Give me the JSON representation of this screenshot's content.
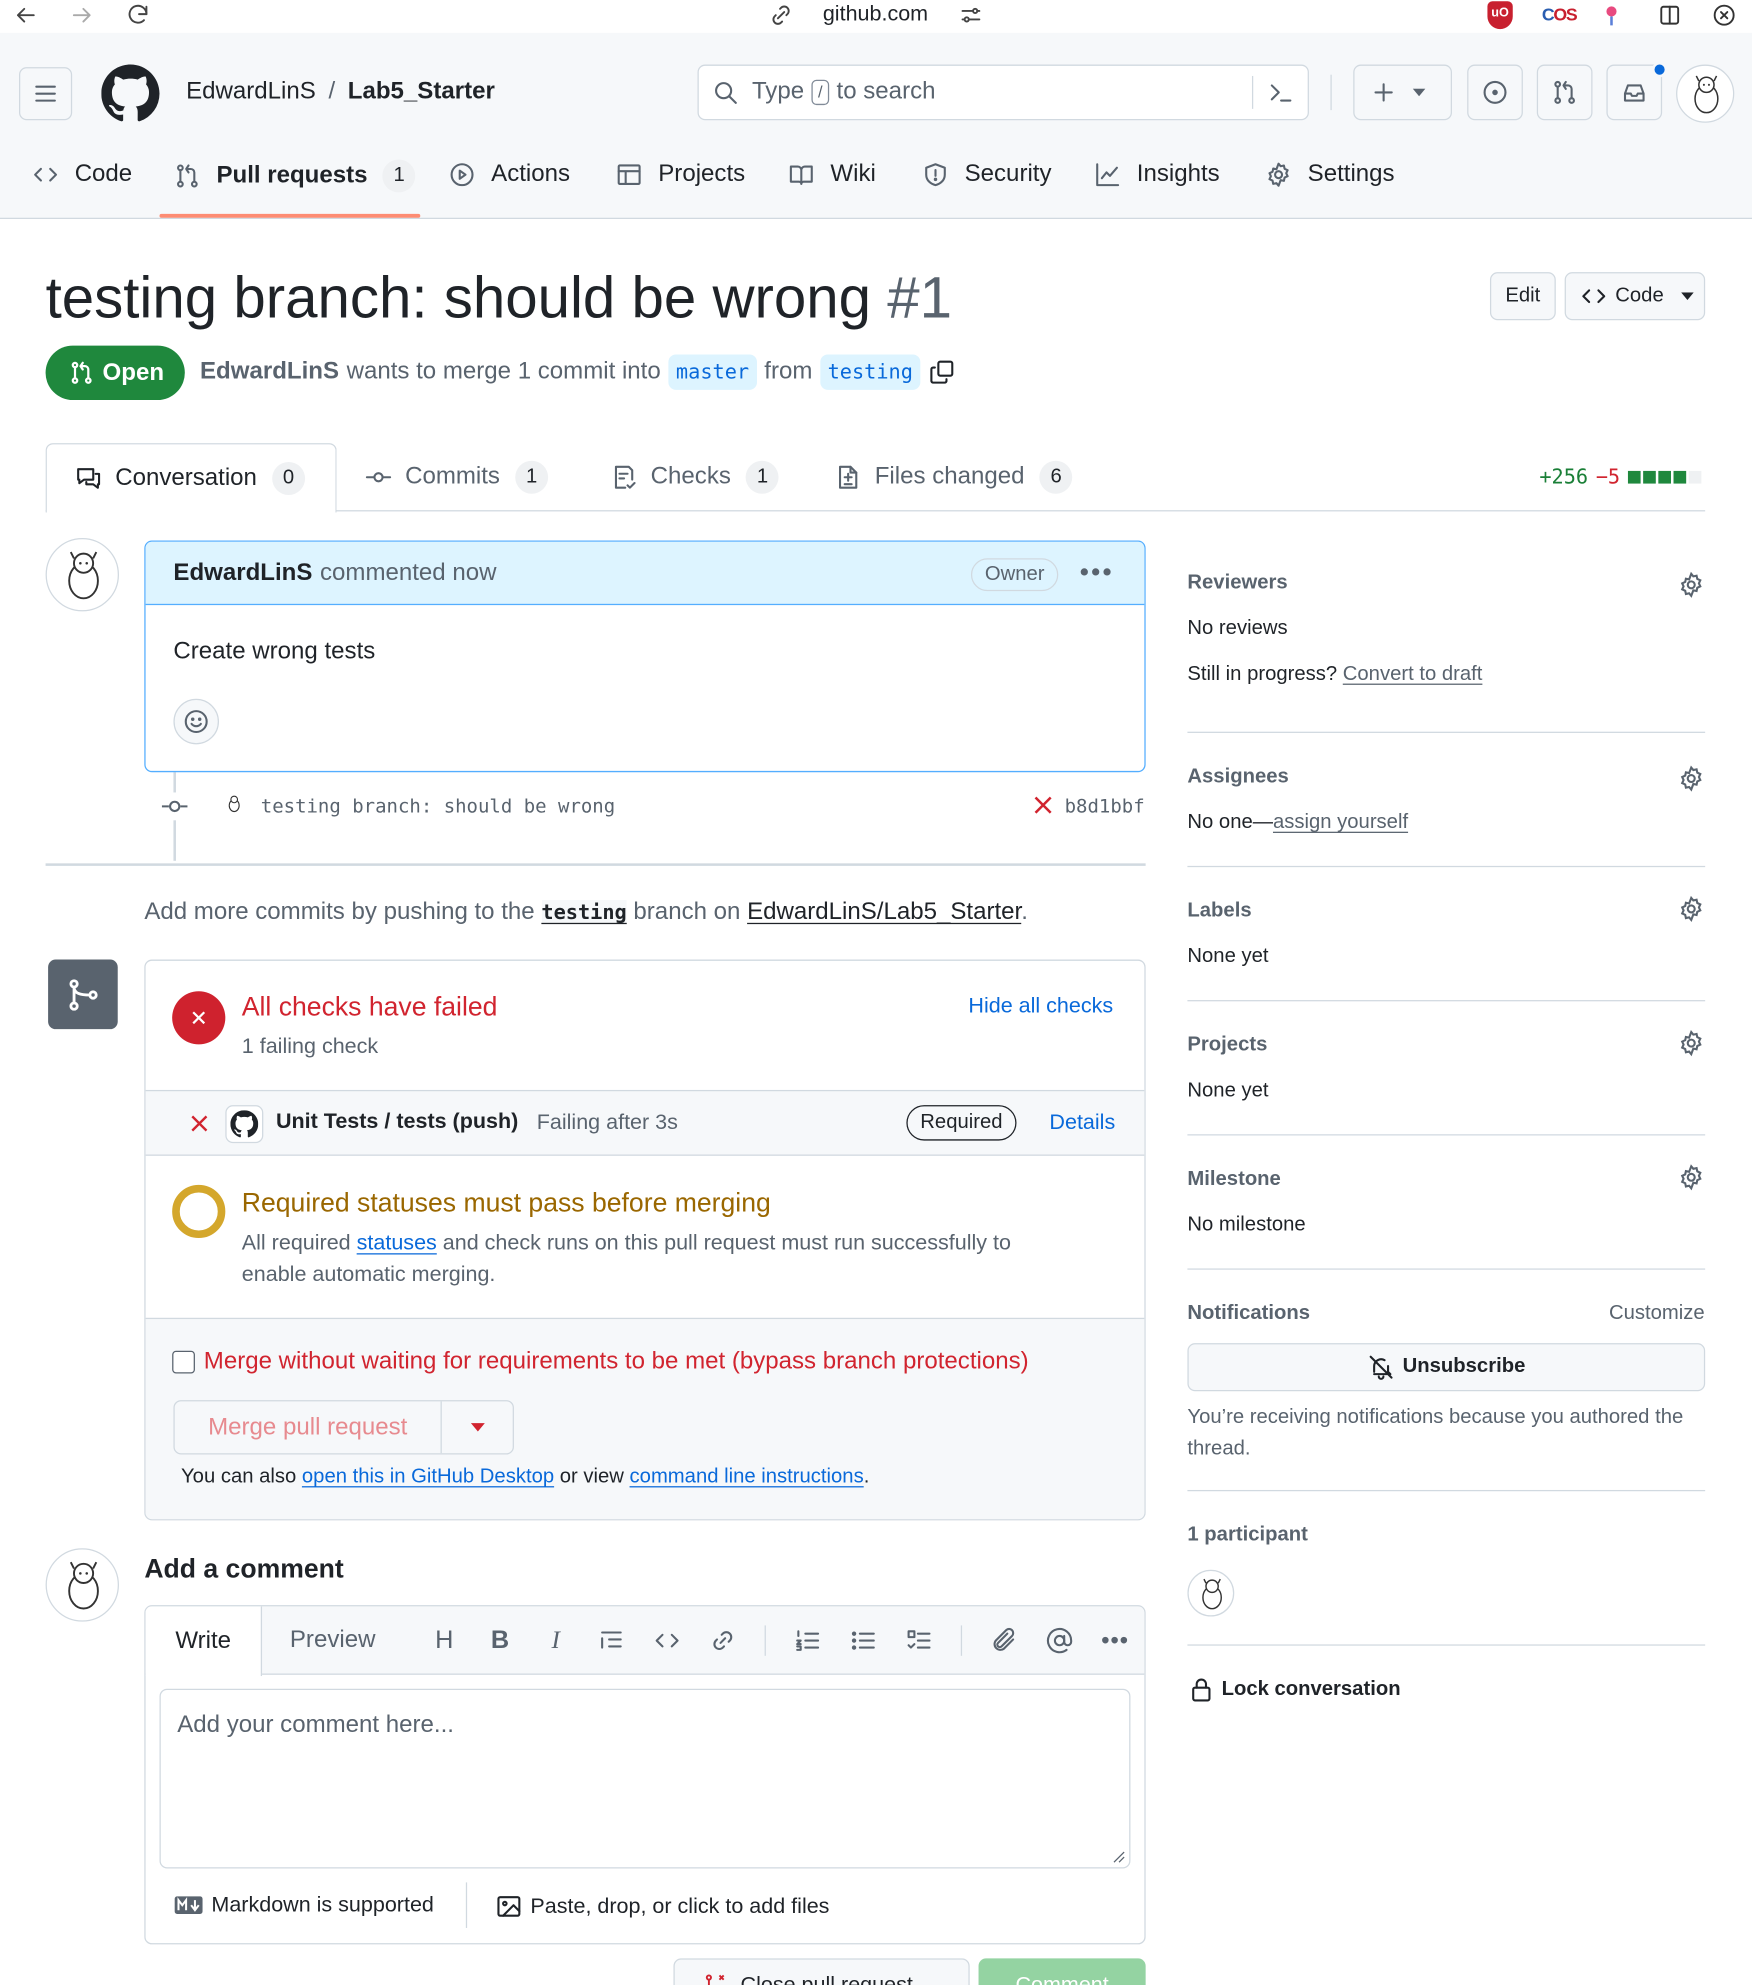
{
  "browser": {
    "url": "github.com"
  },
  "header": {
    "owner": "EdwardLinS",
    "separator": "/",
    "repo": "Lab5_Starter",
    "search_type": "Type",
    "search_key": "/",
    "search_rest": "to search"
  },
  "repo_nav": {
    "code": "Code",
    "pull_requests": "Pull requests",
    "pull_requests_count": "1",
    "actions": "Actions",
    "projects": "Projects",
    "wiki": "Wiki",
    "security": "Security",
    "insights": "Insights",
    "settings": "Settings"
  },
  "pr": {
    "title": "testing branch: should be wrong",
    "number": "#1",
    "edit": "Edit",
    "code": "Code",
    "state": "Open",
    "author": "EdwardLinS",
    "meta_1": "wants to merge 1 commit into",
    "base": "master",
    "meta_2": "from",
    "head": "testing"
  },
  "tabs": {
    "conversation": "Conversation",
    "conversation_count": "0",
    "commits": "Commits",
    "commits_count": "1",
    "checks": "Checks",
    "checks_count": "1",
    "files": "Files changed",
    "files_count": "6",
    "additions": "+256",
    "deletions": "−5"
  },
  "comment": {
    "author": "EdwardLinS",
    "action": "commented now",
    "role": "Owner",
    "body": "Create wrong tests"
  },
  "commit": {
    "message": "testing branch: should be wrong",
    "sha": "b8d1bbf"
  },
  "push_hint": {
    "prefix": "Add more commits by pushing to the",
    "branch": "testing",
    "middle": "branch on",
    "repo": "EdwardLinS/Lab5_Starter",
    "suffix": "."
  },
  "checks": {
    "title": "All checks have failed",
    "subtitle": "1 failing check",
    "hide": "Hide all checks",
    "check_name": "Unit Tests / tests (push)",
    "check_status": "Failing after 3s",
    "required": "Required",
    "details": "Details",
    "req_title": "Required statuses must pass before merging",
    "req_text_1": "All required",
    "req_link": "statuses",
    "req_text_2": "and check runs on this pull request must run successfully to enable automatic merging."
  },
  "merge": {
    "bypass": "Merge without waiting for requirements to be met (bypass branch protections)",
    "button": "Merge pull request",
    "also_1": "You can also",
    "desktop_link": "open this in GitHub Desktop",
    "also_2": "or view",
    "cli_link": "command line instructions",
    "also_3": "."
  },
  "add_comment": {
    "title": "Add a comment",
    "write": "Write",
    "preview": "Preview",
    "placeholder": "Add your comment here...",
    "markdown": "Markdown is supported",
    "files": "Paste, drop, or click to add files",
    "close_pr": "Close pull request",
    "comment_btn": "Comment"
  },
  "sidebar": {
    "reviewers": "Reviewers",
    "reviewers_value": "No reviews",
    "draft_q": "Still in progress?",
    "draft_link": "Convert to draft",
    "assignees": "Assignees",
    "assignees_value": "No one—",
    "assign_link": "assign yourself",
    "labels": "Labels",
    "labels_value": "None yet",
    "projects": "Projects",
    "projects_value": "None yet",
    "milestone": "Milestone",
    "milestone_value": "No milestone",
    "notifications": "Notifications",
    "customize": "Customize",
    "unsubscribe": "Unsubscribe",
    "notif_reason": "You’re receiving notifications because you authored the thread.",
    "participants": "1 participant",
    "lock": "Lock conversation"
  },
  "colors": {
    "accent": "#0969da",
    "open_green": "#1f883d",
    "danger": "#d1242f",
    "attention": "#bf8700",
    "tab_underline": "#fd8c73"
  }
}
